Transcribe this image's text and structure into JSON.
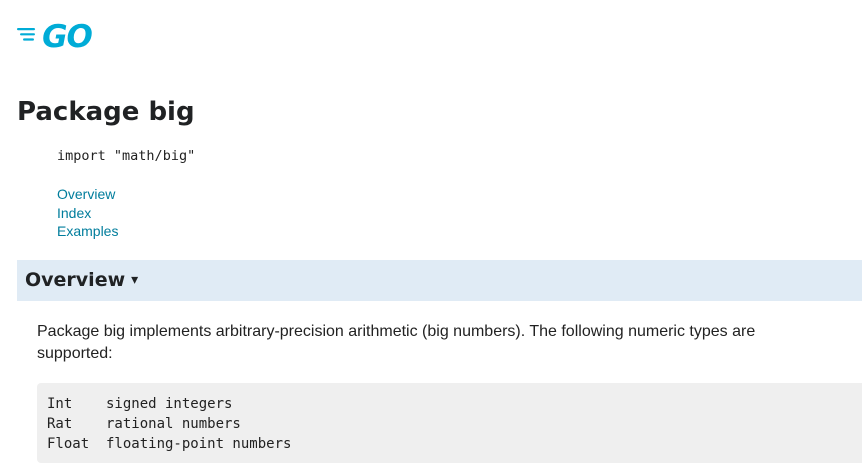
{
  "header": {
    "logo_icon": "go-logo-icon",
    "brand_color": "#00acd7"
  },
  "package": {
    "title": "Package big",
    "import_keyword": "import",
    "import_path": "\"math/big\""
  },
  "toc": {
    "items": [
      {
        "label": "Overview"
      },
      {
        "label": "Index"
      },
      {
        "label": "Examples"
      }
    ],
    "link_color": "#007d9c"
  },
  "overview": {
    "heading": "Overview",
    "toggle_glyph": "▾",
    "bar_color": "#e0ebf5",
    "description": "Package big implements arbitrary-precision arithmetic (big numbers). The following numeric types are supported:",
    "types": [
      {
        "name": "Int",
        "desc": "signed integers"
      },
      {
        "name": "Rat",
        "desc": "rational numbers"
      },
      {
        "name": "Float",
        "desc": "floating-point numbers"
      }
    ],
    "code_bg": "#efefef"
  }
}
